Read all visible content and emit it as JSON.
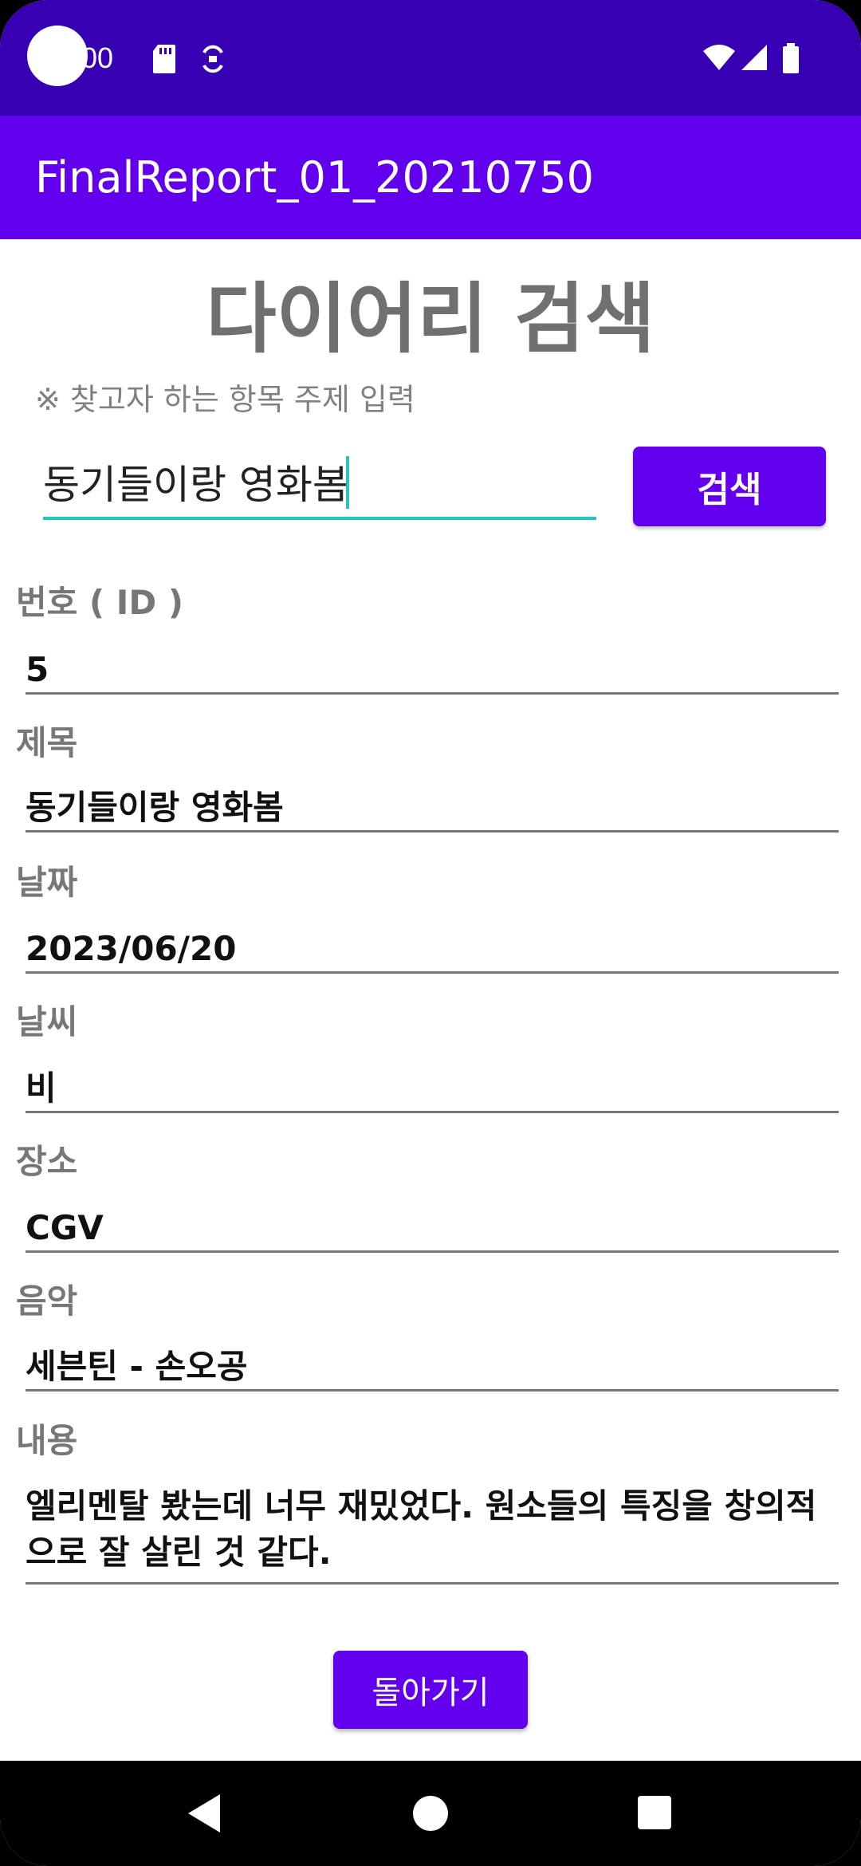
{
  "status_bar": {
    "time": ":00"
  },
  "app_bar": {
    "title": "FinalReport_01_20210750"
  },
  "main": {
    "page_title": "다이어리 검색",
    "hint": "※ 찾고자 하는 항목 주제 입력",
    "search": {
      "value": "동기들이랑 영화봄",
      "button_label": "검색"
    },
    "fields": {
      "id": {
        "label": "번호 ( ID )",
        "value": "5"
      },
      "title": {
        "label": "제목",
        "value": "동기들이랑 영화봄"
      },
      "date": {
        "label": "날짜",
        "value": "2023/06/20"
      },
      "weather": {
        "label": "날씨",
        "value": "비"
      },
      "place": {
        "label": "장소",
        "value": "CGV"
      },
      "music": {
        "label": "음악",
        "value": "세븐틴 - 손오공"
      },
      "content": {
        "label": "내용",
        "value": "엘리멘탈 봤는데 너무 재밌었다. 원소들의 특징을 창의적으로 잘 살린 것 같다."
      }
    },
    "back_button_label": "돌아가기"
  },
  "colors": {
    "status_bar": "#3700B3",
    "app_bar": "#6200EE",
    "accent": "#26C6BA",
    "button": "#6200EE"
  },
  "icons": [
    "sd-card-icon",
    "sync-icon",
    "wifi-icon",
    "cell-signal-icon",
    "battery-icon",
    "nav-back-icon",
    "nav-home-icon",
    "nav-recent-icon"
  ]
}
